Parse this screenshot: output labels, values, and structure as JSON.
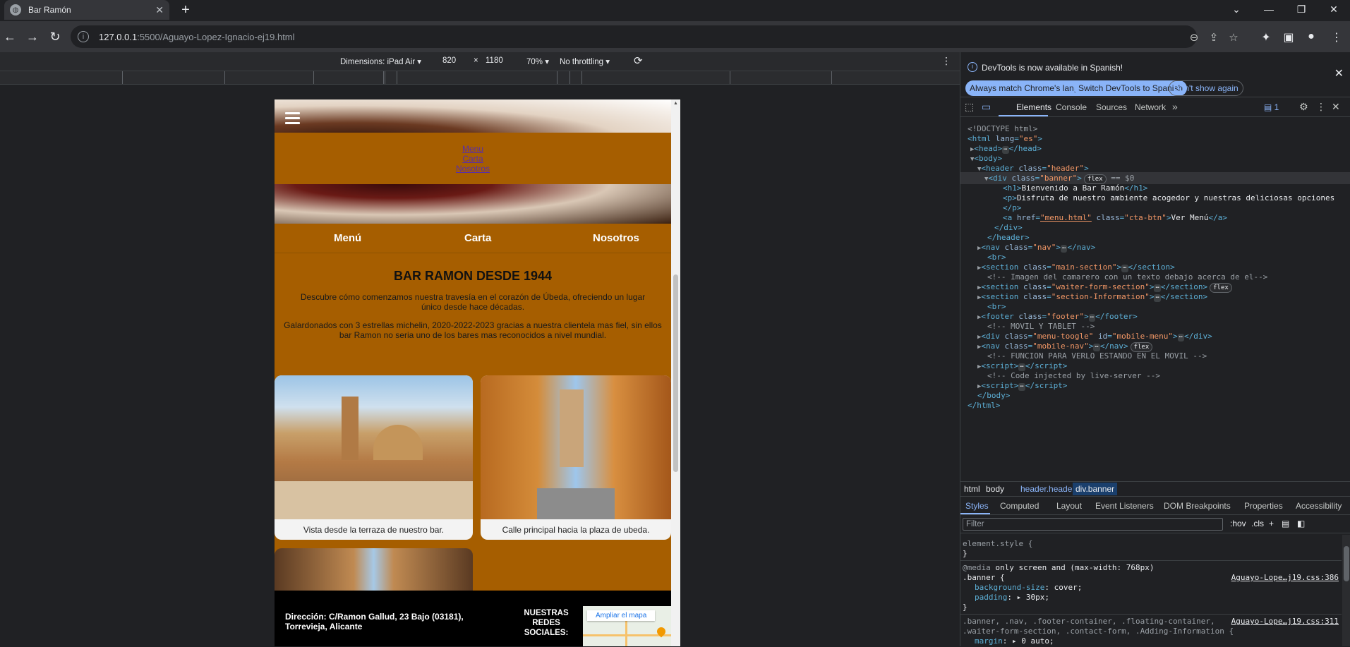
{
  "browser": {
    "tab_title": "Bar Ramón",
    "url_host": "127.0.0.1",
    "url_path": ":5500/Aguayo-Lopez-Ignacio-ej19.html"
  },
  "device_toolbar": {
    "dimensions_label": "Dimensions: iPad Air",
    "width": "820",
    "times": "×",
    "height": "1180",
    "zoom": "70%",
    "throttling": "No throttling"
  },
  "page": {
    "mobile_nav": [
      "Menu",
      "Carta",
      "Nosotros"
    ],
    "main_nav": [
      "Menú",
      "Carta",
      "Nosotros"
    ],
    "intro_title": "BAR RAMON DESDE 1944",
    "intro_p1": "Descubre cómo comenzamos nuestra travesía en el corazón de Úbeda, ofreciendo un lugar único desde hace décadas.",
    "intro_p2": "Galardonados con 3 estrellas michelin, 2020-2022-2023 gracias a nuestra clientela mas fiel, sin ellos bar Ramon no seria uno de los bares mas reconocidos a nivel mundial.",
    "caption1": "Vista desde la terraza de nuestro bar.",
    "caption2": "Calle principal hacia la plaza de ubeda.",
    "footer_address": "Dirección: C/Ramon Gallud, 23 Bajo (03181), Torrevieja, Alicante",
    "footer_social": "NUESTRAS REDES SOCIALES:",
    "map_link": "Ampliar el mapa"
  },
  "devtools": {
    "info_message": "DevTools is now available in Spanish!",
    "btn_always_match": "Always match Chrome's language",
    "btn_switch": "Switch DevTools to Spanish",
    "btn_dont_show": "Don't show again",
    "tabs": [
      "Elements",
      "Console",
      "Sources",
      "Network"
    ],
    "issues_count": "1",
    "breadcrumbs": [
      "html",
      "body",
      "header.header",
      "div.banner"
    ],
    "style_tabs": [
      "Styles",
      "Computed",
      "Layout",
      "Event Listeners",
      "DOM Breakpoints",
      "Properties",
      "Accessibility"
    ],
    "filter_placeholder": "Filter",
    "hov": ":hov",
    "cls": ".cls",
    "dom": {
      "doctype": "<!DOCTYPE html>",
      "html_open_tag": "html",
      "html_lang_attr": "lang",
      "html_lang_val": "\"es\"",
      "head": "head",
      "body": "body",
      "header_class": "\"header\"",
      "banner_class": "\"banner\"",
      "flex_badge": "flex",
      "eq_sel": "== $0",
      "h1_text": "Bienvenido a Bar Ramón",
      "p_text": "Disfruta de nuestro ambiente acogedor y nuestras deliciosas opciones",
      "a_href": "\"menu.html\"",
      "a_class": "\"cta-btn\"",
      "a_text": "Ver Menú",
      "nav_class": "\"nav\"",
      "main_section": "\"main-section\"",
      "comment1": "<!-- Imagen del camarero con un texto debajo acerca de el-->",
      "waiter_section": "\"waiter-form-section\"",
      "info_section": "\"section-Information\"",
      "footer_class": "\"footer\"",
      "comment2": "<!-- MOVIL Y TABLET -->",
      "menu_toogle_class": "\"menu-toogle\"",
      "menu_toogle_id": "\"mobile-menu\"",
      "mobile_nav_class": "\"mobile-nav\"",
      "comment3": "<!-- FUNCION PARA VERLO ESTANDO EN EL MOVIL -->",
      "comment4": "<!-- Code injected by live-server -->"
    },
    "styles": {
      "element_style": "element.style {",
      "close_brace": "}",
      "media_kw": "@media",
      "media_query": " only screen and (max-width: 768px)",
      "banner_sel": ".banner {",
      "bg_size_prop": "background-size",
      "bg_size_val": "cover;",
      "padding_prop": "padding",
      "padding_val": "▸ 30px;",
      "src1": "Aguayo-Lope…j19.css:386",
      "rule2_sel": ".banner, .nav, .footer-container, .floating-container,",
      "rule2_sel2": ".waiter-form-section, .contact-form, .Adding-Information {",
      "margin_prop": "margin",
      "margin_val": "▸ 0 auto;",
      "src2": "Aguayo-Lope…j19.css:311"
    }
  },
  "colors": {
    "page_bg": "#a65e00",
    "devtools_accent": "#8ab4f8"
  }
}
